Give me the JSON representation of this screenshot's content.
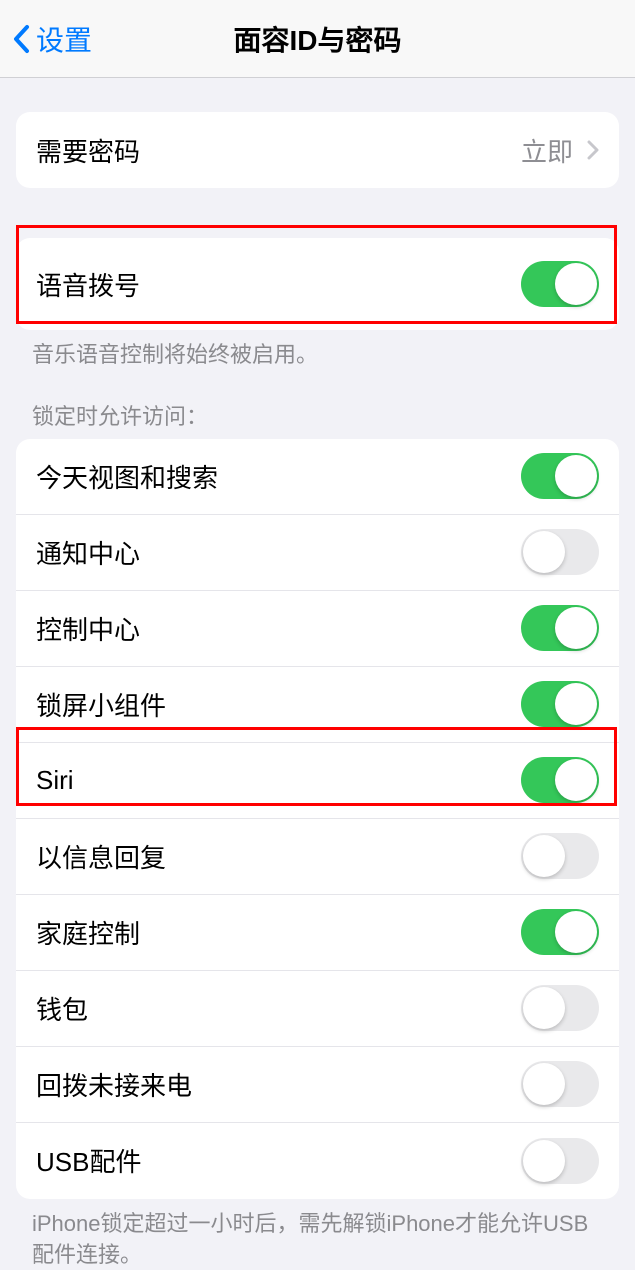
{
  "navbar": {
    "back_label": "设置",
    "title": "面容ID与密码"
  },
  "require_passcode": {
    "label": "需要密码",
    "value": "立即"
  },
  "voice_dial": {
    "label": "语音拨号",
    "footer": "音乐语音控制将始终被启用。"
  },
  "lock_access": {
    "header": "锁定时允许访问：",
    "items": [
      {
        "label": "今天视图和搜索",
        "on": true
      },
      {
        "label": "通知中心",
        "on": false
      },
      {
        "label": "控制中心",
        "on": true
      },
      {
        "label": "锁屏小组件",
        "on": true
      },
      {
        "label": "Siri",
        "on": true
      },
      {
        "label": "以信息回复",
        "on": false
      },
      {
        "label": "家庭控制",
        "on": true
      },
      {
        "label": "钱包",
        "on": false
      },
      {
        "label": "回拨未接来电",
        "on": false
      },
      {
        "label": "USB配件",
        "on": false
      }
    ],
    "footer": "iPhone锁定超过一小时后，需先解锁iPhone才能允许USB配件连接。"
  }
}
